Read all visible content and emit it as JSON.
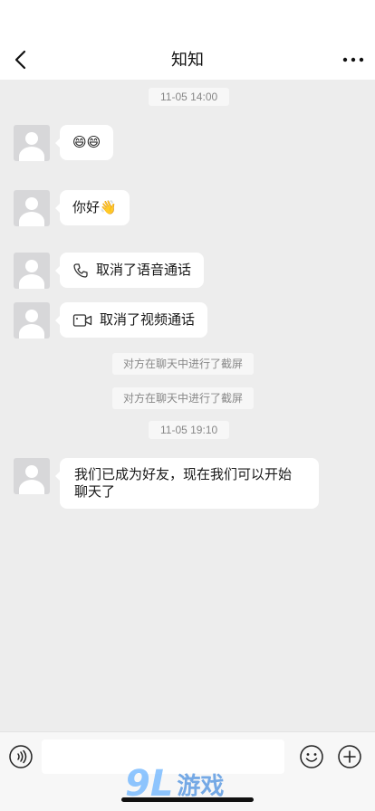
{
  "header": {
    "title": "知知",
    "back_icon": "chevron-left-icon",
    "more_icon": "more-dots-icon"
  },
  "messages": {
    "time_1": "11-05 14:00",
    "msg_emoji": "😄😄",
    "msg_hello": "你好👋",
    "msg_voice_call": "取消了语音通话",
    "msg_video_call": "取消了视频通话",
    "system_1": "对方在聊天中进行了截屏",
    "system_2": "对方在聊天中进行了截屏",
    "time_2": "11-05 19:10",
    "msg_friends": "我们已成为好友，现在我们可以开始聊天了"
  },
  "input_bar": {
    "voice_icon": "voice-icon",
    "input_value": "",
    "emoji_icon": "emoji-icon",
    "add_icon": "plus-circle-icon"
  },
  "watermark": {
    "number": "9L",
    "text": "游戏"
  },
  "colors": {
    "background": "#ededed",
    "bubble": "#ffffff",
    "timestamp_text": "#888888",
    "watermark_blue": "#4a8fe0"
  }
}
